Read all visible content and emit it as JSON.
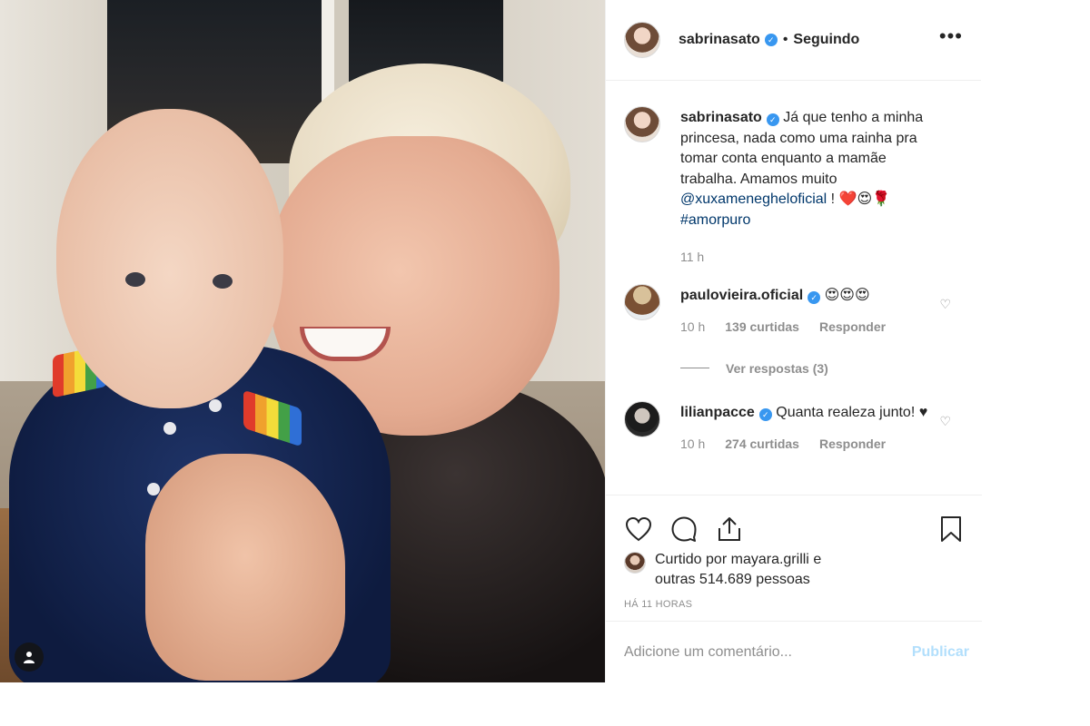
{
  "post": {
    "author": "sabrinasato",
    "follow_status": "Seguindo",
    "more_label": "•••",
    "verified_mark": "✓",
    "caption": {
      "text": "Já que tenho a minha princesa, nada como uma rainha pra tomar conta enquanto a mamãe trabalha. Amamos muito",
      "mention": "@xuxamenegheloficial",
      "after_mention": " ! ❤️😍🌹",
      "hashtag": "#amorpuro",
      "time": "11 h"
    }
  },
  "comments": [
    {
      "username": "paulovieira.oficial",
      "text": "😍😍😍",
      "time": "10 h",
      "likes": "139 curtidas",
      "reply_label": "Responder",
      "view_replies": "Ver respostas (3)"
    },
    {
      "username": "lilianpacce",
      "text": "Quanta realeza junto! ♥",
      "time": "10 h",
      "likes": "274 curtidas",
      "reply_label": "Responder"
    }
  ],
  "actions": {
    "liked_by_prefix": "Curtido por",
    "liked_by_user": "mayara.grilli",
    "liked_by_suffix": "e",
    "others": "outras 514.689 pessoas",
    "timestamp": "HÁ 11 HORAS"
  },
  "comment_box": {
    "placeholder": "Adicione um comentário...",
    "publish_label": "Publicar"
  },
  "colors": {
    "verified": "#3897f0",
    "link": "#00376b",
    "muted": "#8e8e8e",
    "publish_disabled": "#b2dffc"
  }
}
